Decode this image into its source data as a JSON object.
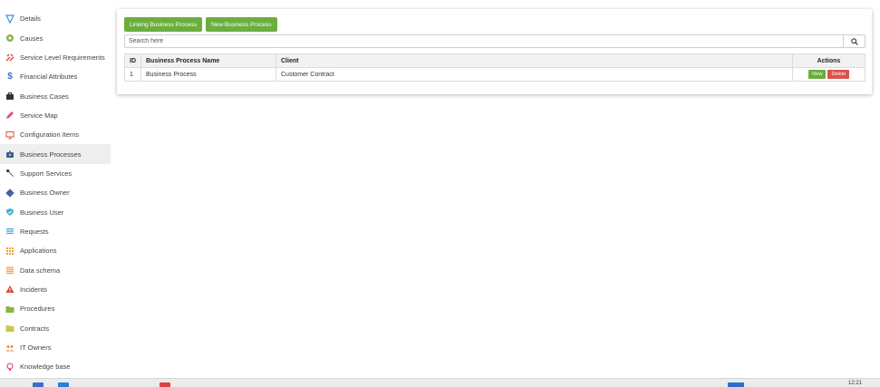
{
  "sidebar": {
    "items": [
      {
        "label": "Details",
        "icon": "filter-icon",
        "color": "#3d8ee0",
        "active": false
      },
      {
        "label": "Causes",
        "icon": "circle-icon",
        "color": "#8ab44a",
        "active": false
      },
      {
        "label": "Service Level Requirements",
        "icon": "broken-link-icon",
        "color": "#e0503c",
        "active": false
      },
      {
        "label": "Financial Attributes",
        "icon": "dollar-icon",
        "color": "#3d6fd0",
        "active": false
      },
      {
        "label": "Business Cases",
        "icon": "briefcase-icon",
        "color": "#333333",
        "active": false
      },
      {
        "label": "Service Map",
        "icon": "pencil-icon",
        "color": "#e05080",
        "active": false
      },
      {
        "label": "Configuration Items",
        "icon": "monitor-icon",
        "color": "#e0503c",
        "active": false
      },
      {
        "label": "Business Processes",
        "icon": "toolbox-icon",
        "color": "#3d5f8a",
        "active": true
      },
      {
        "label": "Support Services",
        "icon": "wrench-icon",
        "color": "#333333",
        "active": false
      },
      {
        "label": "Business Owner",
        "icon": "gear-icon",
        "color": "#3d5fa0",
        "active": false
      },
      {
        "label": "Business User",
        "icon": "shield-icon",
        "color": "#3db0d0",
        "active": false
      },
      {
        "label": "Requests",
        "icon": "list-icon",
        "color": "#4aa8e0",
        "active": false
      },
      {
        "label": "Applications",
        "icon": "grid-icon",
        "color": "#f0a030",
        "active": false
      },
      {
        "label": "Data schema",
        "icon": "lines-icon",
        "color": "#f0a030",
        "active": false
      },
      {
        "label": "Incidents",
        "icon": "warning-icon",
        "color": "#e04030",
        "active": false
      },
      {
        "label": "Procedures",
        "icon": "folder-check-icon",
        "color": "#8ab44a",
        "active": false
      },
      {
        "label": "Contracts",
        "icon": "folder-icon",
        "color": "#c8c84a",
        "active": false
      },
      {
        "label": "IT Owners",
        "icon": "people-icon",
        "color": "#f09030",
        "active": false
      },
      {
        "label": "Knowledge base",
        "icon": "lightbulb-icon",
        "color": "#e04060",
        "active": false
      }
    ]
  },
  "toolbar": {
    "link_label": "Linking Business Process",
    "new_label": "New Business Process"
  },
  "search": {
    "placeholder": "Search here",
    "value": ""
  },
  "table": {
    "headers": {
      "id": "ID",
      "name": "Business Process Name",
      "client": "Client",
      "actions": "Actions"
    },
    "rows": [
      {
        "id": "1",
        "name": "Business Process",
        "client": "Customer Contract",
        "view_label": "View",
        "delete_label": "Delete"
      }
    ]
  },
  "taskbar": {
    "clock": "12:21"
  },
  "colors": {
    "accent_green": "#6cae3e",
    "danger_red": "#d9534f",
    "active_bg": "#eeeeee"
  }
}
